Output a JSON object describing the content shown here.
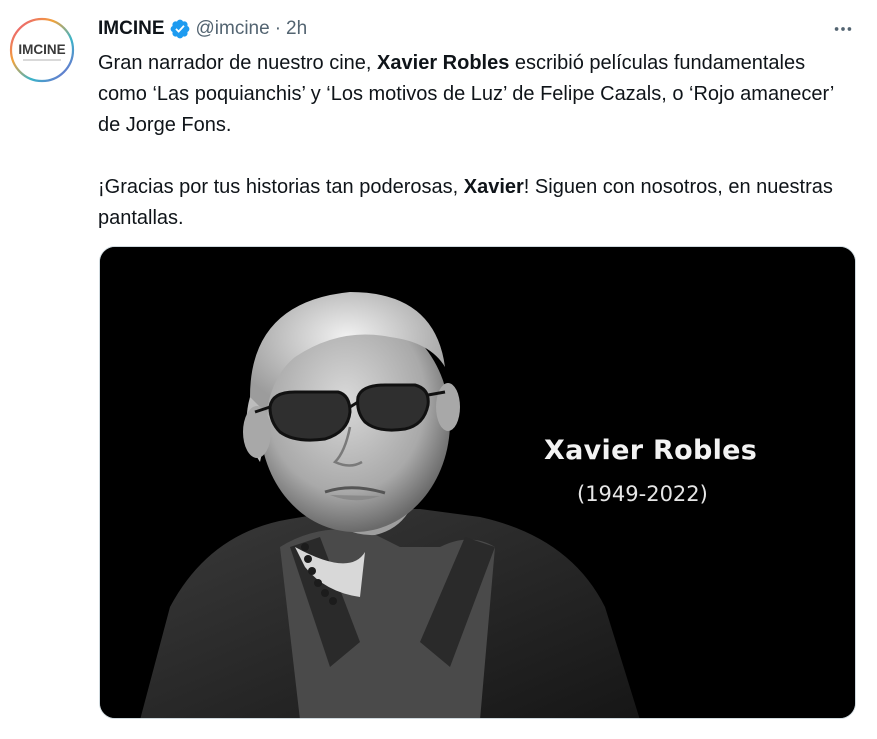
{
  "author": {
    "display_name": "IMCINE",
    "handle": "@imcine",
    "separator": "·",
    "timestamp": "2h",
    "verified_icon": "verified-badge-icon",
    "avatar_logo_text": "IMCINE"
  },
  "more_icon": "more-horizontal-icon",
  "tweet": {
    "p1_a": "Gran narrador de nuestro cine, ",
    "p1_bold": "Xavier Robles",
    "p1_b": " escribió películas fundamentales como ‘Las poquianchis’ y ‘Los motivos de Luz’ de Felipe Cazals, o ‘Rojo amanecer’ de Jorge Fons.",
    "p2_a": "¡Gracias por tus historias tan poderosas, ",
    "p2_bold": "Xavier",
    "p2_b": "! Siguen con nosotros, en nuestras pantallas."
  },
  "media": {
    "name": "Xavier Robles",
    "years": "(1949-2022)",
    "background": "#000000"
  },
  "colors": {
    "verified": "#1d9bf0",
    "secondary_text": "#536471",
    "primary_text": "#0f1419"
  }
}
